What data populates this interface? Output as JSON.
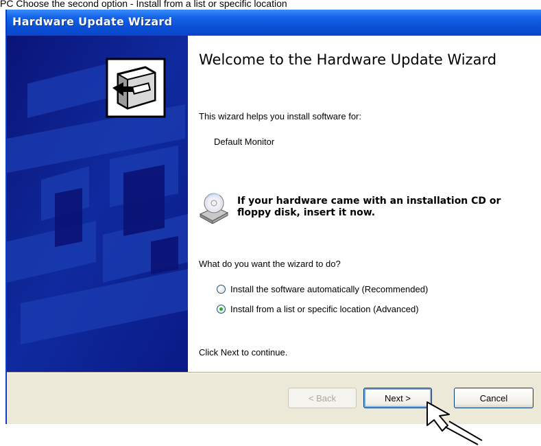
{
  "top_strip_text": "PC Choose the second option - Install from a list or specific location",
  "window": {
    "title": "Hardware Update Wizard"
  },
  "wizard": {
    "heading": "Welcome to the Hardware Update Wizard",
    "intro": "This wizard helps you install software for:",
    "device": "Default Monitor",
    "cd_message": "If your hardware came with an installation CD or floppy disk, insert it now.",
    "question": "What do you want the wizard to do?",
    "options": [
      {
        "label": "Install the software automatically (Recommended)",
        "selected": false
      },
      {
        "label": "Install from a list or specific location (Advanced)",
        "selected": true
      }
    ],
    "continue_hint": "Click Next to continue."
  },
  "buttons": {
    "back": "< Back",
    "next": "Next >",
    "cancel": "Cancel"
  },
  "icons": {
    "hardware": "hardware-card-icon",
    "cd": "cd-drive-icon",
    "cursor": "arrow-cursor-icon"
  }
}
